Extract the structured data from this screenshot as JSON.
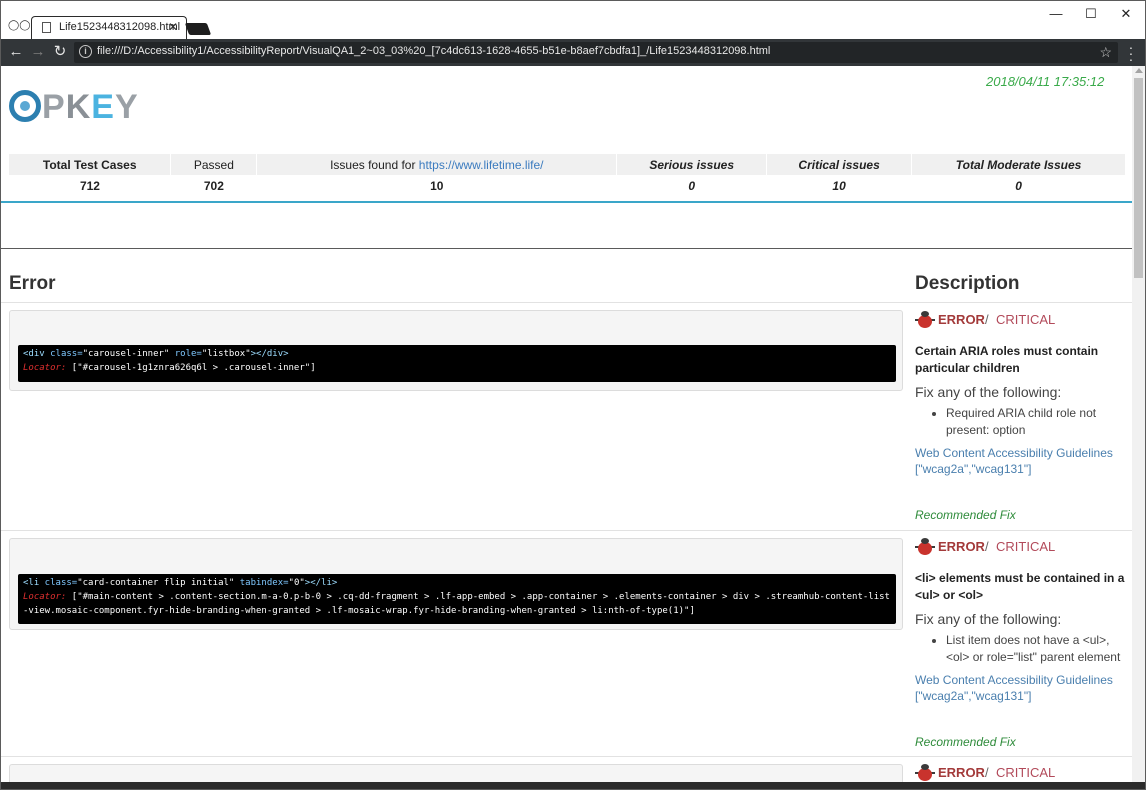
{
  "browser": {
    "tab_title": "Life1523448312098.html",
    "url": "file:///D:/Accessibility1/AccessibilityReport/VisualQA1_2~03_03%20_[7c4dc613-1628-4655-b51e-b8aef7cbdfa1]_/Life1523448312098.html"
  },
  "report": {
    "timestamp": "2018/04/11 17:35:12",
    "logo_letters": [
      "P",
      "K",
      "E",
      "Y"
    ],
    "summary": {
      "headers": {
        "total": "Total Test Cases",
        "passed": "Passed",
        "issues_prefix": "Issues found for ",
        "issues_link": "https://www.lifetime.life/",
        "serious": "Serious issues",
        "critical": "Critical issues",
        "moderate": "Total Moderate Issues"
      },
      "values": {
        "total": "712",
        "passed": "702",
        "issues": "10",
        "serious": "0",
        "critical": "10",
        "moderate": "0"
      }
    },
    "columns": {
      "error": "Error",
      "description": "Description"
    },
    "results": [
      {
        "code_open": "<div",
        "code_attr1": " class=",
        "code_val1": "\"carousel-inner\"",
        "code_attr2": " role=",
        "code_val2": "\"listbox\"",
        "code_close": "></div>",
        "locator_label": "Locator:",
        "locator": " [\"#carousel-1g1znra626q6l > .carousel-inner\"]",
        "severity_label": "ERROR",
        "severity_sep": "/",
        "severity_level": "CRITICAL",
        "rule_title": "Certain ARIA roles must contain particular children",
        "fix_heading": "Fix any of the following:",
        "fix_item": "Required ARIA child role not present: option",
        "guide_link": "Web Content Accessibility Guidelines",
        "guide_tags": "[\"wcag2a\",\"wcag131\"]",
        "recommended": "Recommended Fix"
      },
      {
        "code_open": "<li",
        "code_attr1": " class=",
        "code_val1": "\"card-container flip initial\"",
        "code_attr2": " tabindex=",
        "code_val2": "\"0\"",
        "code_close": "></li>",
        "locator_label": "Locator:",
        "locator": " [\"#main-content > .content-section.m-a-0.p-b-0 > .cq-dd-fragment > .lf-app-embed > .app-container > .elements-container > div > .streamhub-content-list-view.mosaic-component.fyr-hide-branding-when-granted > .lf-mosaic-wrap.fyr-hide-branding-when-granted > li:nth-of-type(1)\"]",
        "severity_label": "ERROR",
        "severity_sep": "/",
        "severity_level": "CRITICAL",
        "rule_title": "<li> elements must be contained in a <ul> or <ol>",
        "fix_heading": "Fix any of the following:",
        "fix_item": "List item does not have a <ul>, <ol> or role=\"list\" parent element",
        "guide_link": "Web Content Accessibility Guidelines",
        "guide_tags": "[\"wcag2a\",\"wcag131\"]",
        "recommended": "Recommended Fix"
      },
      {
        "severity_label": "ERROR",
        "severity_sep": "/",
        "severity_level": "CRITICAL"
      }
    ]
  }
}
